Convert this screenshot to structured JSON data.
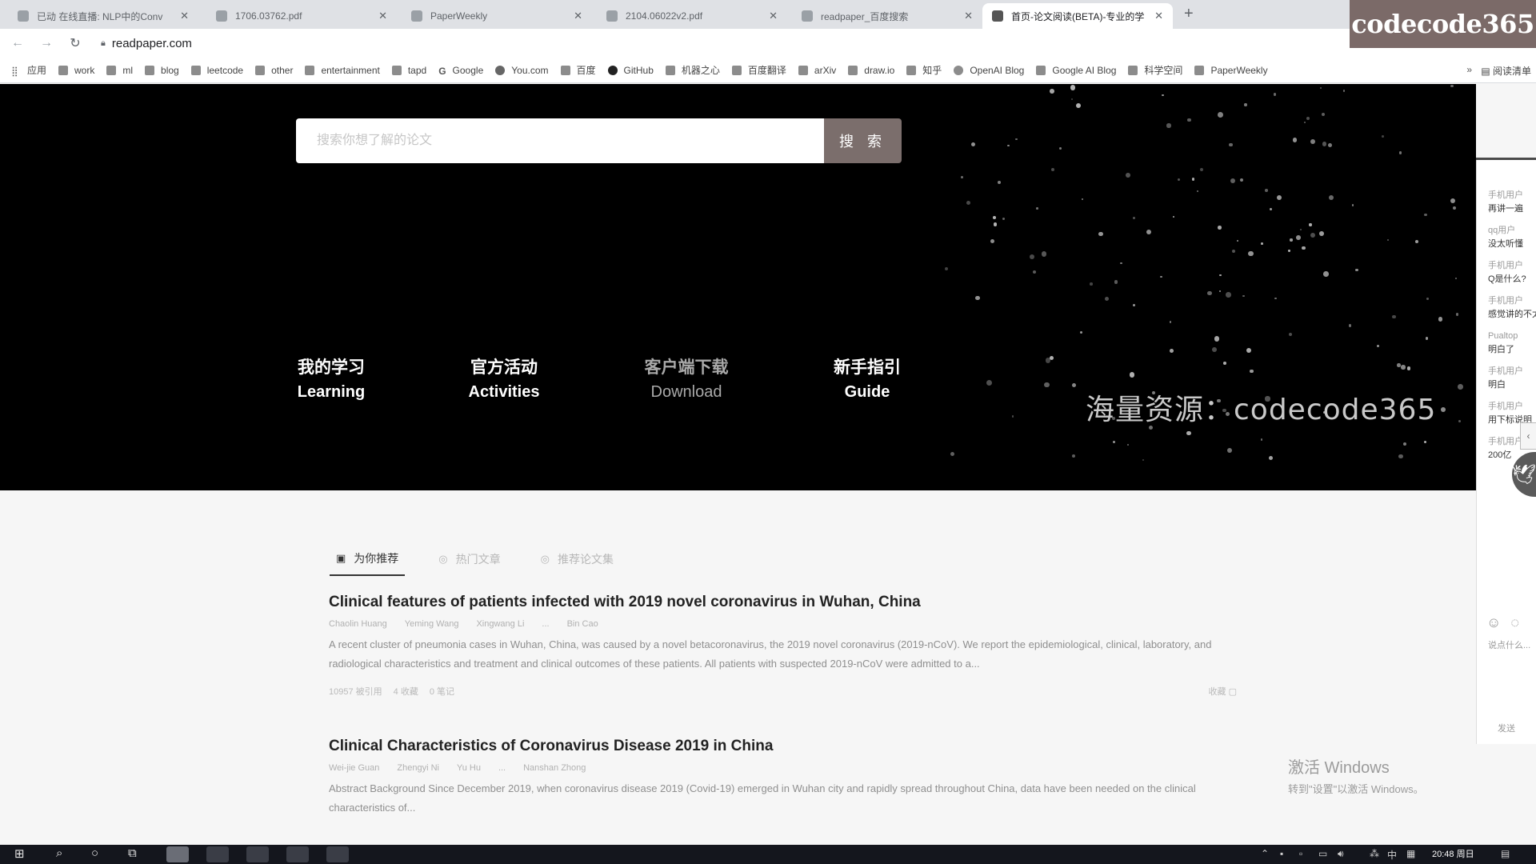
{
  "browser": {
    "tabs": [
      {
        "title": "已动 在线直播: NLP中的Conv",
        "active": false
      },
      {
        "title": "1706.03762.pdf",
        "active": false
      },
      {
        "title": "PaperWeekly",
        "active": false
      },
      {
        "title": "2104.06022v2.pdf",
        "active": false
      },
      {
        "title": "readpaper_百度搜索",
        "active": false
      },
      {
        "title": "首页-论文阅读(BETA)-专业的学",
        "active": true
      }
    ],
    "new_tab": "+",
    "url": "readpaper.com",
    "bookmarks": [
      "应用",
      "work",
      "ml",
      "blog",
      "leetcode",
      "other",
      "entertainment",
      "tapd",
      "Google",
      "You.com",
      "百度",
      "GitHub",
      "机器之心",
      "百度翻译",
      "arXiv",
      "draw.io",
      "知乎",
      "OpenAI Blog",
      "Google AI Blog",
      "科学空间",
      "PaperWeekly"
    ],
    "bookmarks_more": "»",
    "reading_list": "阅读清单"
  },
  "overlay_watermark": "codecode365",
  "hero": {
    "search_placeholder": "搜索你想了解的论文",
    "search_button": "搜 索",
    "nav": [
      {
        "zh": "我的学习",
        "en": "Learning"
      },
      {
        "zh": "官方活动",
        "en": "Activities"
      },
      {
        "zh": "客户端下载",
        "en": "Download"
      },
      {
        "zh": "新手指引",
        "en": "Guide"
      }
    ],
    "watermark": "海量资源：codecode365"
  },
  "content": {
    "tabs": [
      {
        "label": "为你推荐",
        "icon": "bookmark-icon"
      },
      {
        "label": "热门文章",
        "icon": "fire-icon"
      },
      {
        "label": "推荐论文集",
        "icon": "collection-icon"
      }
    ],
    "papers": [
      {
        "title": "Clinical features of patients infected with 2019 novel coronavirus in Wuhan, China",
        "authors": [
          "Chaolin Huang",
          "Yeming Wang",
          "Xingwang Li",
          "...",
          "Bin Cao"
        ],
        "abstract": "A recent cluster of pneumonia cases in Wuhan, China, was caused by a novel betacoronavirus, the 2019 novel coronavirus (2019-nCoV). We report the epidemiological, clinical, laboratory, and radiological characteristics and treatment and clinical outcomes of these patients. All patients with suspected 2019-nCoV were admitted to a...",
        "stats": [
          "10957 被引用",
          "4 收藏",
          "0 笔记"
        ],
        "actions": "收藏"
      },
      {
        "title": "Clinical Characteristics of Coronavirus Disease 2019 in China",
        "authors": [
          "Wei-jie Guan",
          "Zhengyi Ni",
          "Yu Hu",
          "...",
          "Nanshan Zhong"
        ],
        "abstract": "Abstract Background Since December 2019, when coronavirus disease 2019 (Covid-19) emerged in Wuhan city and rapidly spread throughout China, data have been needed on the clinical characteristics of..."
      }
    ]
  },
  "chat": {
    "messages": [
      {
        "user": "手机用户",
        "text": "再讲一遍"
      },
      {
        "user": "qq用户",
        "text": "没太听懂"
      },
      {
        "user": "手机用户",
        "text": "Q是什么?"
      },
      {
        "user": "手机用户",
        "text": "感觉讲的不太懂"
      },
      {
        "user": "Pualtop",
        "text": "明白了"
      },
      {
        "user": "手机用户",
        "text": "明白"
      },
      {
        "user": "手机用户",
        "text": "用下标说明"
      },
      {
        "user": "手机用户",
        "text": "200亿"
      }
    ],
    "hint": "说点什么...",
    "send": "发送"
  },
  "windows_activation": {
    "line1": "激活 Windows",
    "line2": "转到\"设置\"以激活 Windows。"
  },
  "taskbar": {
    "clock": "20:48 周日",
    "lang": "中"
  }
}
